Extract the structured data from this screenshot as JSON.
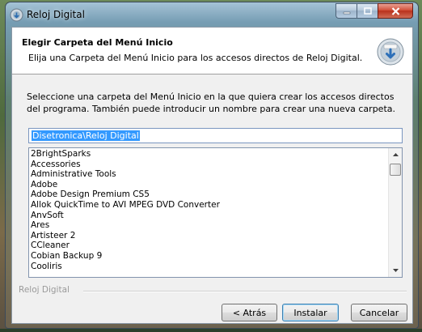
{
  "window": {
    "title": "Reloj Digital",
    "caption_buttons": {
      "minimize": "—",
      "maximize": "□",
      "close": "✕"
    }
  },
  "header": {
    "title": "Elegir Carpeta del Menú Inicio",
    "subtitle": "Elija una Carpeta del Menú Inicio para los accesos directos de Reloj Digital.",
    "icon": "installer-disc-icon"
  },
  "instructions": "Seleccione una carpeta del Menú Inicio en la que quiera crear los accesos directos del programa. También puede introducir un nombre para crear una nueva carpeta.",
  "folder_input": {
    "value": "Disetronica\\Reloj Digital"
  },
  "folder_list": {
    "items": [
      "2BrightSparks",
      "Accessories",
      "Administrative Tools",
      "Adobe",
      "Adobe Design Premium CS5",
      "Allok QuickTime to AVI MPEG DVD Converter",
      "AnvSoft",
      "Ares",
      "Artisteer 2",
      "CCleaner",
      "Cobian Backup 9",
      "Cooliris"
    ]
  },
  "branding": "Reloj Digital",
  "buttons": {
    "back": "< Atrás",
    "install": "Instalar",
    "cancel": "Cancelar"
  },
  "colors": {
    "selection": "#3399ff",
    "close_button": "#c8402a",
    "default_button_border": "#3c7fb1"
  }
}
